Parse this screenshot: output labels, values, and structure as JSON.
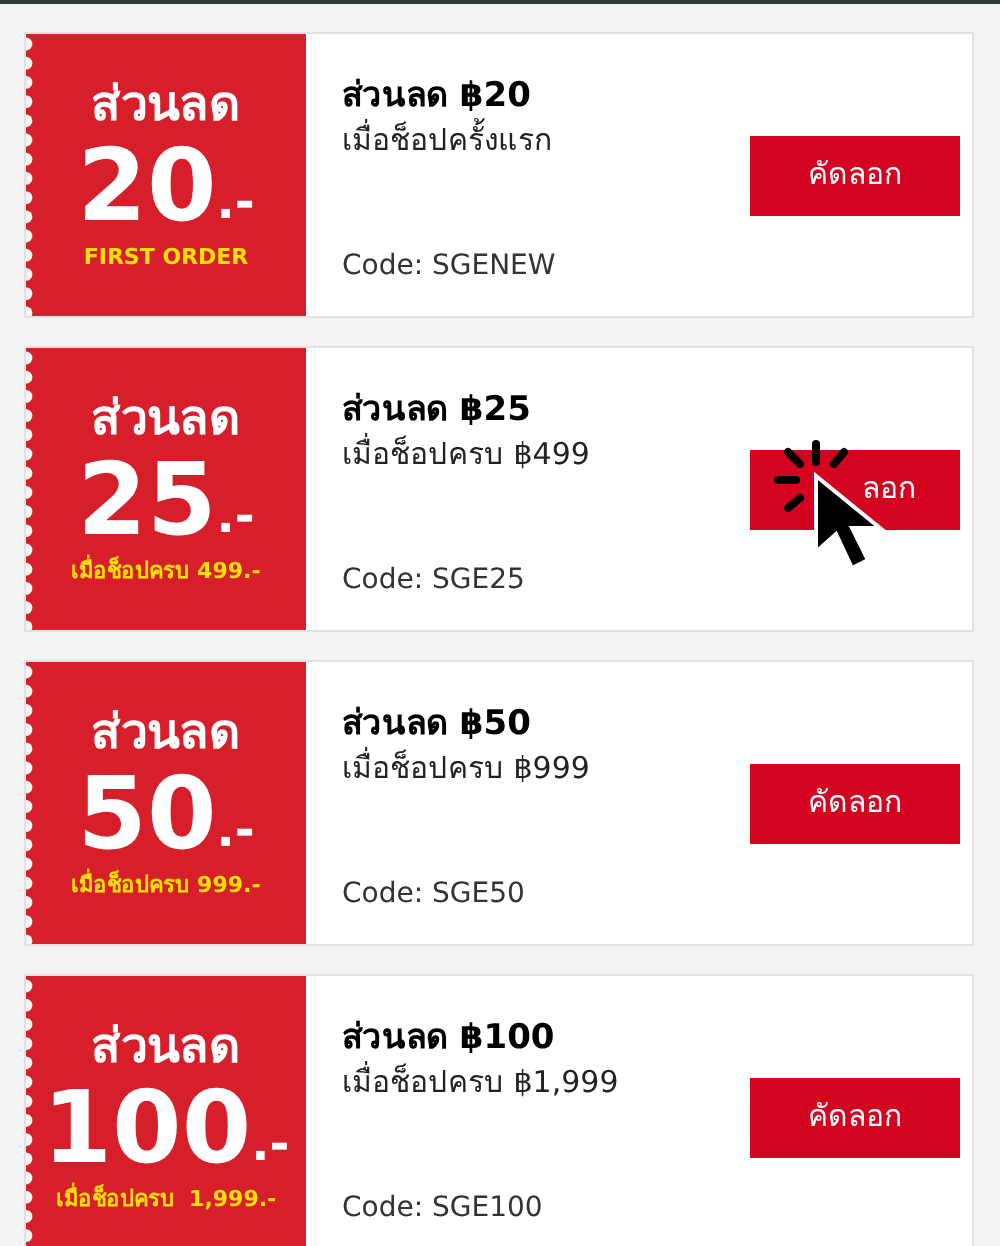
{
  "coupons": [
    {
      "stub_label": "ส่วนลด",
      "stub_amount": "20",
      "stub_suffix": ".-",
      "stub_note": "FIRST ORDER",
      "title": "ส่วนลด ฿20",
      "condition": "เมื่อช็อปครั้งแรก",
      "code": "Code: SGENEW",
      "button": "คัดลอก",
      "cursor": false
    },
    {
      "stub_label": "ส่วนลด",
      "stub_amount": "25",
      "stub_suffix": ".-",
      "stub_note": "เมื่อช็อปครบ 499.-",
      "title": "ส่วนลด ฿25",
      "condition": "เมื่อช็อปครบ ฿499",
      "code": "Code: SGE25",
      "button": "ลอก",
      "cursor": true
    },
    {
      "stub_label": "ส่วนลด",
      "stub_amount": "50",
      "stub_suffix": ".-",
      "stub_note": "เมื่อช็อปครบ 999.-",
      "title": "ส่วนลด ฿50",
      "condition": "เมื่อช็อปครบ ฿999",
      "code": "Code: SGE50",
      "button": "คัดลอก",
      "cursor": false
    },
    {
      "stub_label": "ส่วนลด",
      "stub_amount": "100",
      "stub_suffix": ".-",
      "stub_note": "เมื่อช็อปครบ  1,999.-",
      "title": "ส่วนลด ฿100",
      "condition": "เมื่อช็อปครบ ฿1,999",
      "code": "Code: SGE100",
      "button": "คัดลอก",
      "cursor": false
    }
  ]
}
